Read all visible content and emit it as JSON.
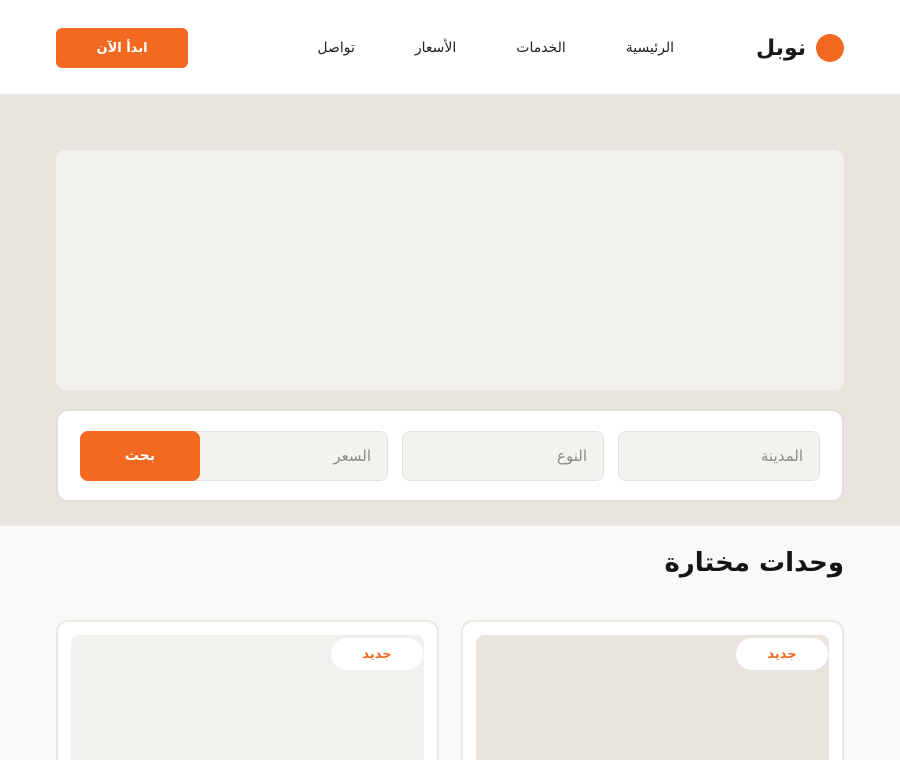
{
  "header": {
    "brand_name": "نوبل",
    "nav": [
      "الرئيسية",
      "الخدمات",
      "الأسعار",
      "تواصل"
    ],
    "cta_label": "ابدأ الآن"
  },
  "search": {
    "city_placeholder": "المدينة",
    "type_placeholder": "النوع",
    "price_placeholder": "السعر",
    "button_label": "بحث"
  },
  "featured": {
    "title": "وحدات مختارة",
    "cards": [
      {
        "badge": "جديد"
      },
      {
        "badge": "جديد"
      }
    ]
  },
  "colors": {
    "accent": "#f26a21",
    "hero_bg": "#e9e4de",
    "panel_bg": "#f2f1ed"
  }
}
